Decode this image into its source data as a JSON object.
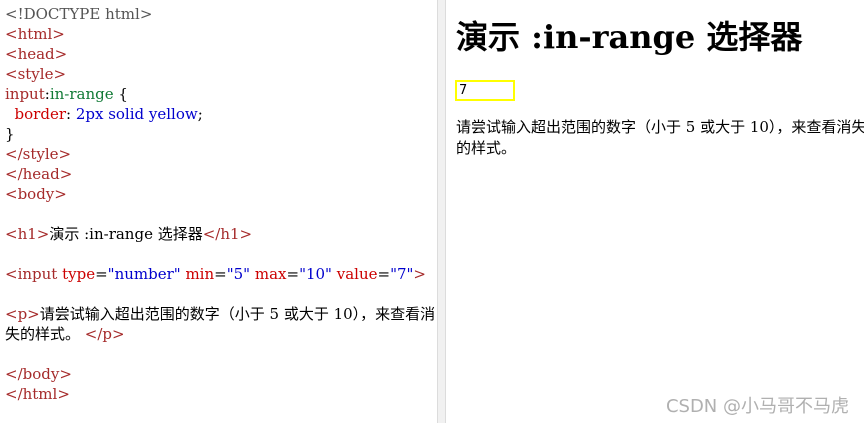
{
  "code_lines": {
    "l1": "<!DOCTYPE html>",
    "l2": "<html>",
    "l3": "<head>",
    "l4": "<style>",
    "l5_sel": "input",
    "l5_colon": ":",
    "l5_pseudo": "in-range",
    "l5_brace": " {",
    "l6_prop": "border",
    "l6_colon": ": ",
    "l6_val": "2px solid yellow",
    "l6_semi": ";",
    "l7": "}",
    "l8": "</style>",
    "l9": "</head>",
    "l10": "<body>",
    "l12_open": "<h1>",
    "l12_text": "演示 :in-range 选择器",
    "l12_close": "</h1>",
    "l14_tag": "<input",
    "l14_a1": "type",
    "l14_v1": "\"number\"",
    "l14_a2": "min",
    "l14_v2": "\"5\"",
    "l14_a3": "max",
    "l14_v3": "\"10\"",
    "l14_a4": "value",
    "l14_v4": "\"7\"",
    "l14_end": ">",
    "l16_open": "<p>",
    "l16_text": "请尝试输入超出范围的数字（小于 5 或大于 10），来查看消",
    "l17_text": "失的样式。 ",
    "l17_close": "</p>",
    "l19": "</body>",
    "l20": "</html>"
  },
  "preview": {
    "heading": "演示 :in-range 选择器",
    "input_value": "7",
    "input_min": "5",
    "input_max": "10",
    "paragraph": "请尝试输入超出范围的数字（小于 5 或大于 10），来查看消失的样式。"
  },
  "watermark": "CSDN @小马哥不马虎"
}
